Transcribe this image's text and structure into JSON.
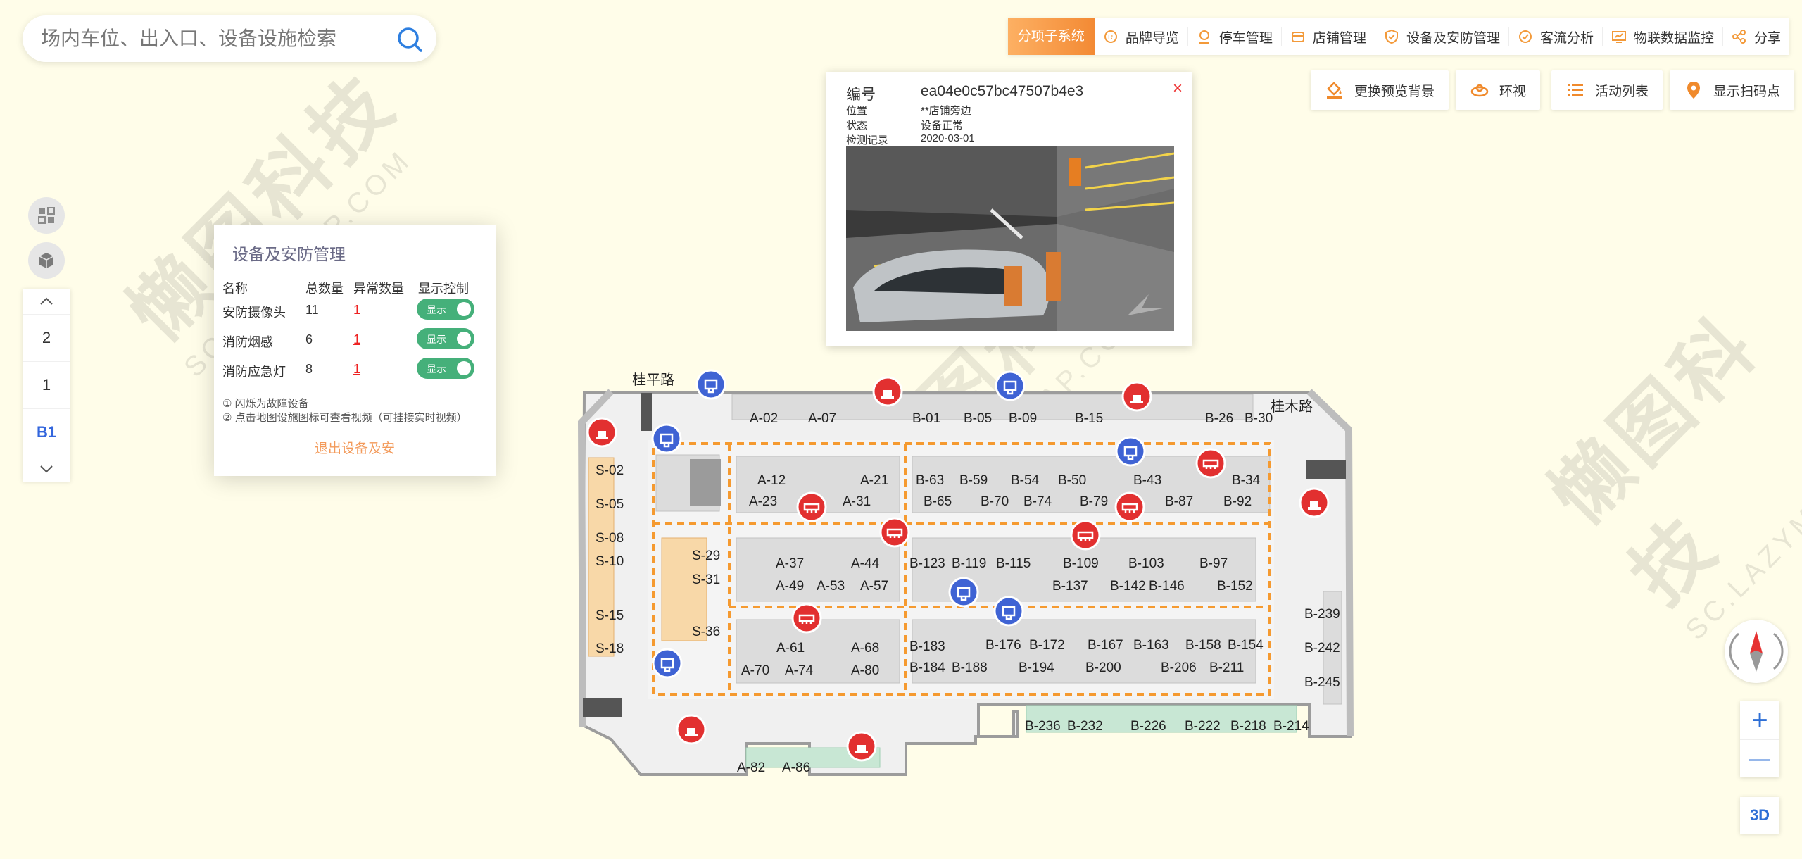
{
  "search": {
    "placeholder": "场内车位、出入口、设备设施检索"
  },
  "nav": {
    "subsystem": "分项子系统",
    "items": [
      "品牌导览",
      "停车管理",
      "店铺管理",
      "设备及安防管理",
      "客流分析",
      "物联数据监控",
      "分享"
    ]
  },
  "tools": [
    "更换预览背景",
    "环视",
    "活动列表",
    "显示扫码点"
  ],
  "floors": [
    "2",
    "1",
    "B1"
  ],
  "active_floor": "B1",
  "panel": {
    "title": "设备及安防管理",
    "headers": [
      "名称",
      "总数量",
      "异常数量",
      "显示控制"
    ],
    "rows": [
      {
        "name": "安防摄像头",
        "total": "11",
        "abnormal": "1",
        "toggle": "显示"
      },
      {
        "name": "消防烟感",
        "total": "6",
        "abnormal": "1",
        "toggle": "显示"
      },
      {
        "name": "消防应急灯",
        "total": "8",
        "abnormal": "1",
        "toggle": "显示"
      }
    ],
    "notes": [
      "① 闪烁为故障设备",
      "② 点击地图设施图标可查看视频（可挂接实时视频）"
    ],
    "exit": "退出设备及安"
  },
  "popup": {
    "id_label": "编号",
    "id_value": "ea04e0c57bc47507b4e3",
    "location_label": "位置",
    "location_value": "**店铺旁边",
    "status_label": "状态",
    "status_value": "设备正常",
    "record_label": "检测记录",
    "record_value": "2020-03-01"
  },
  "map": {
    "roads": [
      "桂平路",
      "桂木路"
    ],
    "slots": [
      [
        "A-02",
        1065,
        600
      ],
      [
        "A-07",
        1148,
        600
      ],
      [
        "B-01",
        1296,
        600
      ],
      [
        "B-05",
        1369,
        600
      ],
      [
        "B-09",
        1433,
        600
      ],
      [
        "B-15",
        1527,
        600
      ],
      [
        "B-26",
        1712,
        600
      ],
      [
        "B-30",
        1768,
        600
      ],
      [
        "S-02",
        846,
        674
      ],
      [
        "A-12",
        1076,
        688
      ],
      [
        "A-21",
        1222,
        688
      ],
      [
        "B-63",
        1301,
        688
      ],
      [
        "B-59",
        1363,
        688
      ],
      [
        "B-54",
        1436,
        688
      ],
      [
        "B-50",
        1503,
        688
      ],
      [
        "B-43",
        1610,
        688
      ],
      [
        "B-34",
        1750,
        688
      ],
      [
        "S-05",
        846,
        722
      ],
      [
        "A-23",
        1064,
        718
      ],
      [
        "A-31",
        1197,
        718
      ],
      [
        "B-65",
        1312,
        718
      ],
      [
        "B-70",
        1393,
        718
      ],
      [
        "B-74",
        1454,
        718
      ],
      [
        "B-79",
        1534,
        718
      ],
      [
        "B-87",
        1655,
        718
      ],
      [
        "B-92",
        1738,
        718
      ],
      [
        "S-08",
        846,
        770
      ],
      [
        "S-29",
        983,
        795
      ],
      [
        "A-37",
        1102,
        806
      ],
      [
        "A-44",
        1209,
        806
      ],
      [
        "B-123",
        1292,
        806
      ],
      [
        "B-119",
        1352,
        806
      ],
      [
        "B-115",
        1415,
        806
      ],
      [
        "B-109",
        1510,
        806
      ],
      [
        "B-103",
        1603,
        806
      ],
      [
        "B-97",
        1704,
        806
      ],
      [
        "S-10",
        846,
        803
      ],
      [
        "S-31",
        983,
        829
      ],
      [
        "A-49",
        1102,
        838
      ],
      [
        "A-53",
        1160,
        838
      ],
      [
        "A-57",
        1222,
        838
      ],
      [
        "B-137",
        1495,
        838
      ],
      [
        "B-142",
        1577,
        838
      ],
      [
        "B-146",
        1632,
        838
      ],
      [
        "B-152",
        1729,
        838
      ],
      [
        "S-15",
        846,
        880
      ],
      [
        "S-36",
        983,
        903
      ],
      [
        "A-61",
        1103,
        926
      ],
      [
        "A-68",
        1209,
        926
      ],
      [
        "B-183",
        1292,
        924
      ],
      [
        "B-176",
        1400,
        922
      ],
      [
        "B-172",
        1462,
        922
      ],
      [
        "B-167",
        1545,
        922
      ],
      [
        "B-163",
        1610,
        922
      ],
      [
        "B-158",
        1684,
        922
      ],
      [
        "B-154",
        1744,
        922
      ],
      [
        "S-18",
        846,
        927
      ],
      [
        "A-70",
        1053,
        958
      ],
      [
        "A-74",
        1115,
        958
      ],
      [
        "A-80",
        1209,
        958
      ],
      [
        "B-184",
        1292,
        954
      ],
      [
        "B-188",
        1352,
        954
      ],
      [
        "B-194",
        1447,
        954
      ],
      [
        "B-200",
        1542,
        954
      ],
      [
        "B-206",
        1649,
        954
      ],
      [
        "B-211",
        1718,
        954
      ],
      [
        "B-239",
        1853,
        878
      ],
      [
        "B-242",
        1853,
        926
      ],
      [
        "B-245",
        1853,
        975
      ],
      [
        "B-236",
        1456,
        1037
      ],
      [
        "B-232",
        1516,
        1037
      ],
      [
        "B-226",
        1606,
        1037
      ],
      [
        "B-222",
        1683,
        1037
      ],
      [
        "B-218",
        1748,
        1037
      ],
      [
        "B-214",
        1809,
        1037
      ],
      [
        "A-82",
        1047,
        1096
      ],
      [
        "A-86",
        1111,
        1096
      ]
    ],
    "cameras": [
      [
        1010,
        546
      ],
      [
        947,
        623
      ],
      [
        1435,
        548
      ],
      [
        1606,
        641
      ],
      [
        1369,
        841
      ],
      [
        1433,
        868
      ],
      [
        948,
        942
      ]
    ],
    "smoke": [
      [
        1720,
        658
      ],
      [
        1153,
        720
      ],
      [
        1271,
        756
      ],
      [
        1542,
        760
      ],
      [
        1605,
        720
      ],
      [
        1146,
        878
      ]
    ],
    "lights": [
      [
        1261,
        556
      ],
      [
        1615,
        563
      ],
      [
        855,
        614
      ],
      [
        1867,
        714
      ],
      [
        982,
        1036
      ],
      [
        1224,
        1060
      ]
    ]
  },
  "watermark": [
    "懒图科技",
    "SC.LAZYMAP.COM"
  ],
  "zoom": {
    "in": "+",
    "out": "—"
  },
  "btn3d": "3D"
}
